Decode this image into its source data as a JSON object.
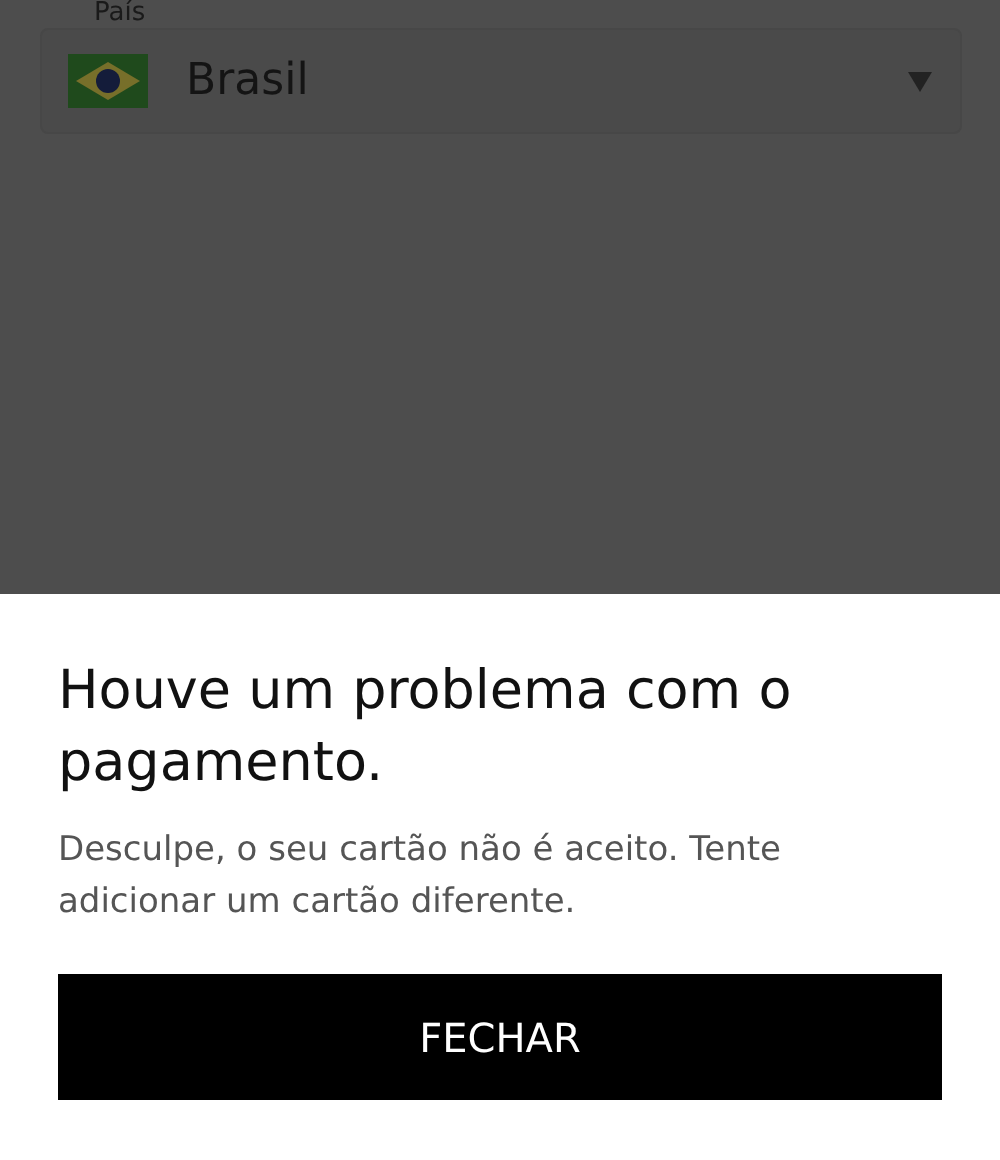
{
  "country_field": {
    "label": "País",
    "value": "Brasil"
  },
  "dialog": {
    "title": "Houve um problema com o pagamento.",
    "message": "Desculpe, o seu cartão não é aceito. Tente adicionar um cartão diferente.",
    "button": "FECHAR"
  }
}
